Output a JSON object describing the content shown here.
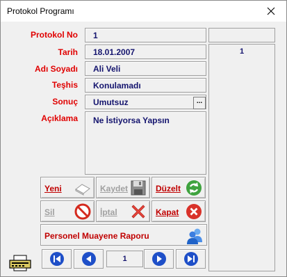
{
  "window": {
    "title": "Protokol Programı"
  },
  "form": {
    "labels": {
      "protokol_no": "Protokol No",
      "tarih": "Tarih",
      "adi_soyadi": "Adı Soyadı",
      "teshis": "Teşhis",
      "sonuc": "Sonuç",
      "aciklama": "Açıklama"
    },
    "values": {
      "protokol_no": "1",
      "tarih": "18.01.2007",
      "adi_soyadi": "Ali Veli",
      "teshis": "Konulamadı",
      "sonuc": "Umutsuz",
      "aciklama": "Ne İstiyorsa Yapsın"
    },
    "sonuc_picker_label": "...",
    "side_list_value": "1"
  },
  "buttons": {
    "yeni": "Yeni",
    "kaydet": "Kaydet",
    "duzelt": "Düzelt",
    "sil": "Sil",
    "iptal": "İptal",
    "kapat": "Kapat",
    "rapor": "Personel Muayene Raporu"
  },
  "navigator": {
    "current": "1"
  },
  "colors": {
    "label_red": "#e00000",
    "value_navy": "#14146e",
    "nav_blue": "#1e4fc8",
    "disabled_gray": "#a0a0a0"
  },
  "icons": {
    "yeni": "eraser-icon",
    "kaydet": "floppy-disk-icon",
    "duzelt": "refresh-icon",
    "sil": "no-entry-icon",
    "iptal": "red-x-icon",
    "kapat": "close-circle-icon",
    "rapor": "people-icon",
    "printer": "printer-icon"
  }
}
